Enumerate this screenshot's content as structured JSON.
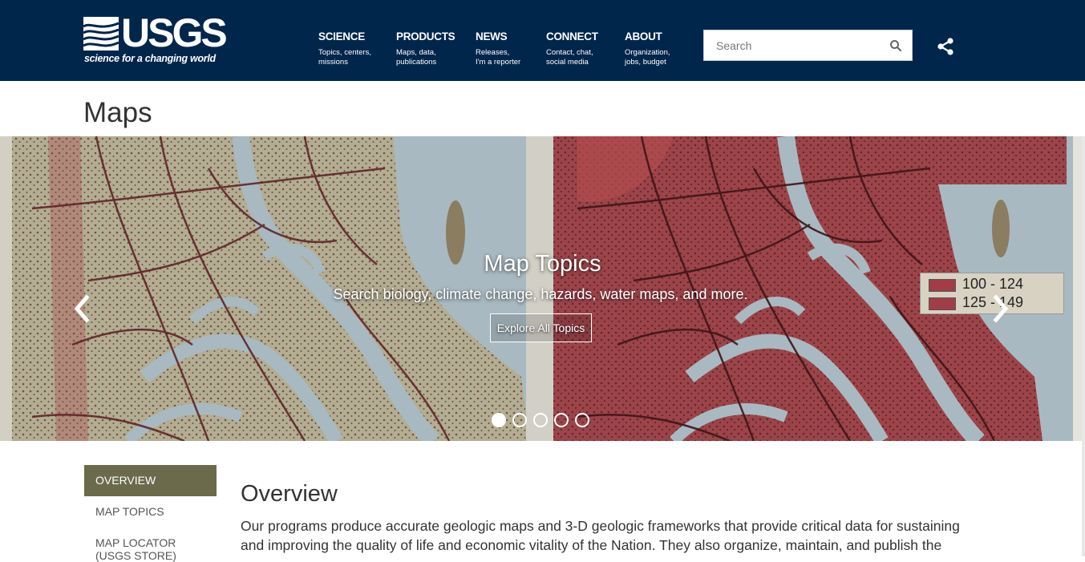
{
  "header": {
    "logo_text": "USGS",
    "tagline": "science for a changing world",
    "nav": [
      {
        "title": "SCIENCE",
        "sub": "Topics, centers,\nmissions"
      },
      {
        "title": "PRODUCTS",
        "sub": "Maps, data,\npublications"
      },
      {
        "title": "NEWS",
        "sub": "Releases,\nI'm a reporter"
      },
      {
        "title": "CONNECT",
        "sub": "Contact, chat,\nsocial media"
      },
      {
        "title": "ABOUT",
        "sub": "Organization,\njobs, budget"
      }
    ],
    "search_placeholder": "Search",
    "search_icon": "search-icon",
    "share_icon": "share-icon"
  },
  "page": {
    "title": "Maps"
  },
  "carousel": {
    "title": "Map Topics",
    "subtitle": "Search biology, climate change, hazards, water maps, and more.",
    "button": "Explore All Topics",
    "legend": [
      "100 - 124",
      "125 - 149"
    ],
    "slide_count": 5,
    "active_slide": 1,
    "prev_icon": "chevron-left-icon",
    "next_icon": "chevron-right-icon"
  },
  "sidebar": {
    "items": [
      {
        "label": "OVERVIEW",
        "active": true
      },
      {
        "label": "MAP TOPICS",
        "active": false
      },
      {
        "label": "MAP LOCATOR\n(USGS STORE)",
        "active": false
      }
    ]
  },
  "main": {
    "heading": "Overview",
    "body": "Our programs produce accurate geologic maps and 3-D geologic frameworks that provide critical data for sustaining and improving the quality of life and economic vitality of the Nation. They also organize, maintain, and publish the"
  },
  "colors": {
    "header_bg": "#00264c",
    "sidebar_active": "#6b6b4c",
    "map_red": "#9c4449",
    "map_water": "#a9b9c1"
  }
}
